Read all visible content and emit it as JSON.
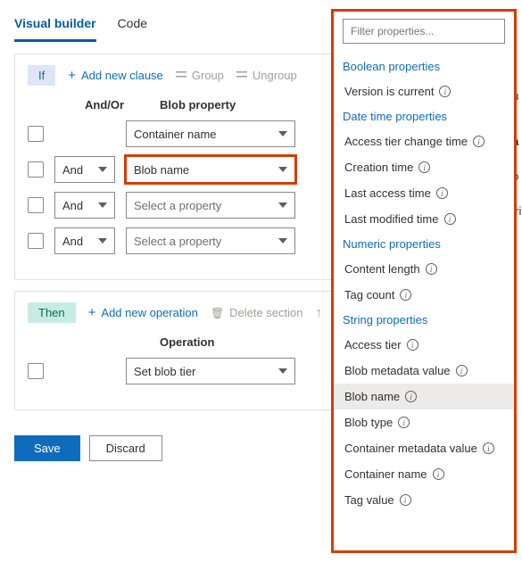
{
  "tabs": {
    "visual": "Visual builder",
    "code": "Code"
  },
  "if": {
    "label": "If",
    "add": "Add new clause",
    "group": "Group",
    "ungroup": "Ungroup",
    "headers": {
      "andor": "And/Or",
      "prop": "Blob property"
    },
    "rows": [
      {
        "andor": "",
        "prop": "Container name",
        "placeholder": false
      },
      {
        "andor": "And",
        "prop": "Blob name",
        "placeholder": false,
        "highlight": true
      },
      {
        "andor": "And",
        "prop": "Select a property",
        "placeholder": true
      },
      {
        "andor": "And",
        "prop": "Select a property",
        "placeholder": true
      }
    ]
  },
  "then": {
    "label": "Then",
    "add": "Add new operation",
    "delete": "Delete section",
    "header": "Operation",
    "row": {
      "op": "Set blob tier"
    }
  },
  "actions": {
    "save": "Save",
    "discard": "Discard"
  },
  "panel": {
    "filter_placeholder": "Filter properties...",
    "groups": [
      {
        "label": "Boolean properties",
        "items": [
          "Version is current"
        ]
      },
      {
        "label": "Date time properties",
        "items": [
          "Access tier change time",
          "Creation time",
          "Last access time",
          "Last modified time"
        ]
      },
      {
        "label": "Numeric properties",
        "items": [
          "Content length",
          "Tag count"
        ]
      },
      {
        "label": "String properties",
        "items": [
          "Access tier",
          "Blob metadata value",
          "Blob name",
          "Blob type",
          "Container metadata value",
          "Container name",
          "Tag value"
        ]
      }
    ],
    "selected": "Blob name"
  },
  "side": {
    "a": "au",
    "b": "va",
    "c": "-lo",
    "d": "stri"
  }
}
